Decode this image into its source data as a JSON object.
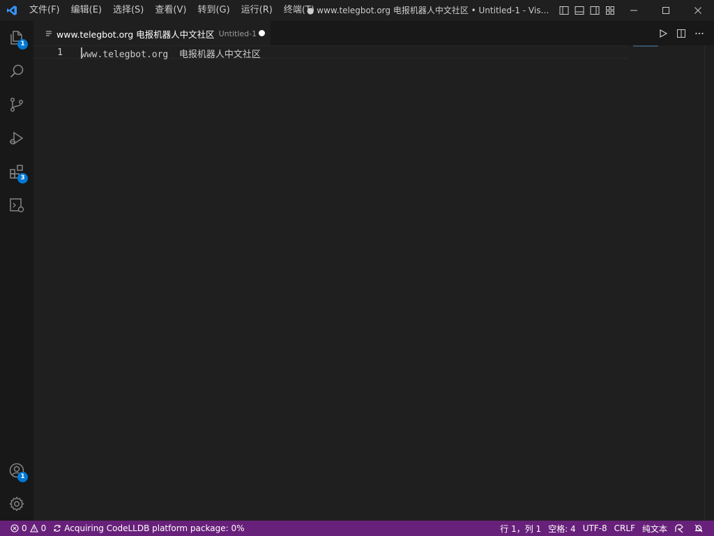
{
  "titlebar": {
    "menu": [
      {
        "id": "file",
        "label": "文件(F)"
      },
      {
        "id": "edit",
        "label": "编辑(E)"
      },
      {
        "id": "selection",
        "label": "选择(S)"
      },
      {
        "id": "view",
        "label": "查看(V)"
      },
      {
        "id": "goto",
        "label": "转到(G)"
      },
      {
        "id": "run",
        "label": "运行(R)"
      },
      {
        "id": "terminal",
        "label": "终端(T)"
      }
    ],
    "window_title": "● www.telegbot.org 电报机器人中文社区 • Untitled-1 - Visual Studio Code",
    "app_icon": "vscode-logo-icon",
    "accent": "#3794ff"
  },
  "activitybar": {
    "items": [
      {
        "id": "explorer",
        "icon": "files-icon",
        "badge": "1"
      },
      {
        "id": "search",
        "icon": "search-icon",
        "badge": ""
      },
      {
        "id": "source-control",
        "icon": "source-control-icon",
        "badge": ""
      },
      {
        "id": "run-debug",
        "icon": "run-debug-icon",
        "badge": ""
      },
      {
        "id": "extensions",
        "icon": "extensions-icon",
        "badge": "3"
      },
      {
        "id": "remote",
        "icon": "remote-explorer-icon",
        "badge": ""
      }
    ],
    "accounts_badge": "1",
    "badge_color": "#0078d4"
  },
  "tab": {
    "label": "www.telegbot.org 电报机器人中文社区",
    "description": "Untitled-1",
    "dirty": true
  },
  "editor": {
    "line_number": "1",
    "line_text": "www.telegbot.org  电报机器人中文社区"
  },
  "statusbar": {
    "errors": "0",
    "warnings": "0",
    "task": "Acquiring CodeLLDB platform package: 0%",
    "position": "行 1，列 1",
    "indent": "空格: 4",
    "encoding": "UTF-8",
    "eol": "CRLF",
    "language": "纯文本",
    "background": "#68217a"
  }
}
